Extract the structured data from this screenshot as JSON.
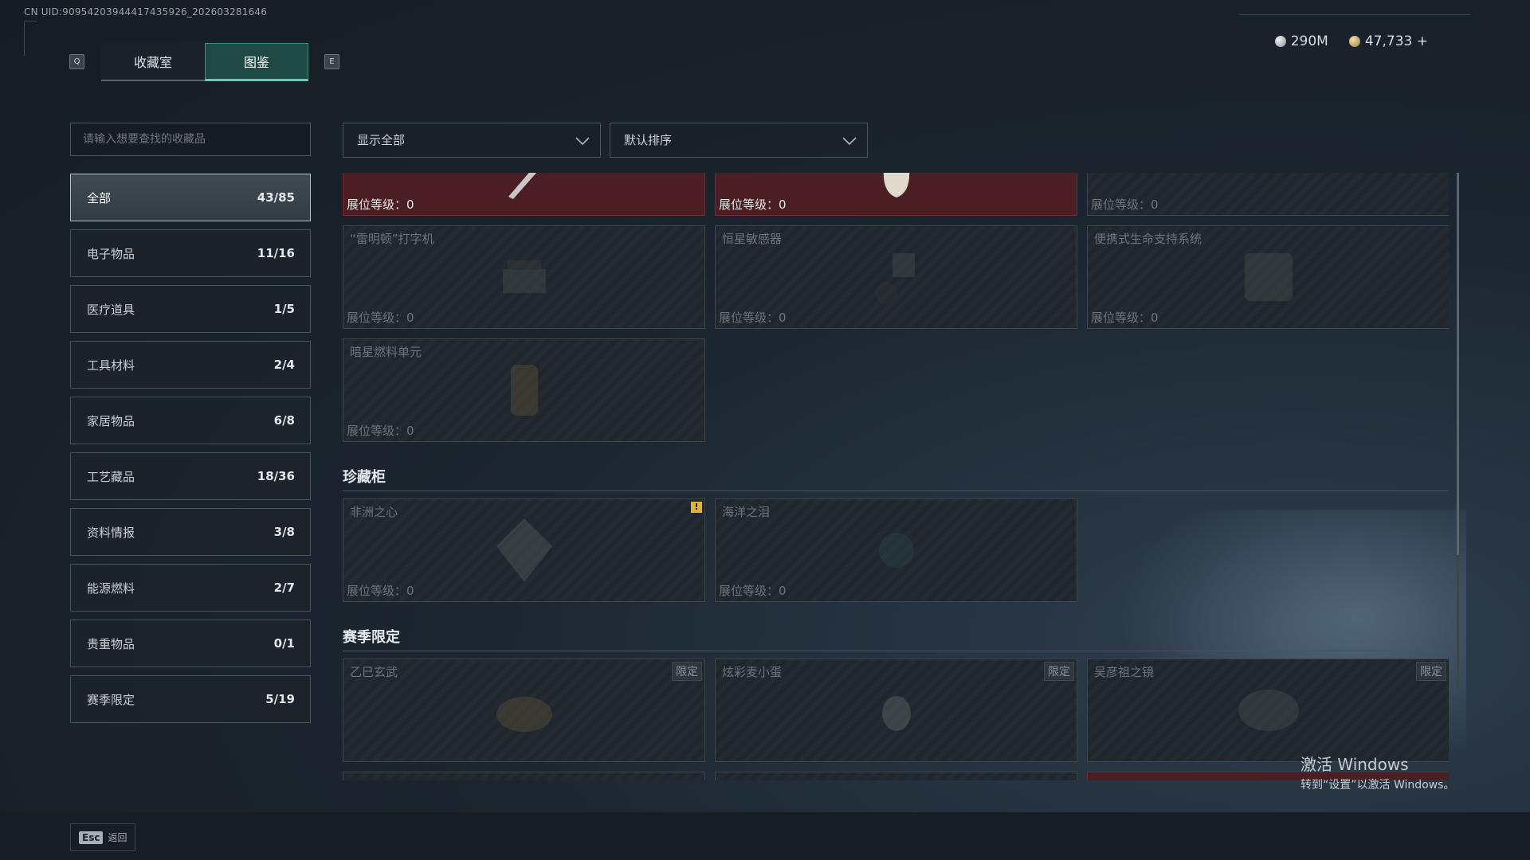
{
  "uid": "CN UID:9095420394441743​5926_202603281646",
  "tabs": {
    "key_left": "Q",
    "key_right": "E",
    "items": [
      {
        "label": "收藏室",
        "active": false
      },
      {
        "label": "图鉴",
        "active": true
      }
    ]
  },
  "currency": {
    "silver": "290M",
    "gold": "47,733 +",
    "accent": "#5ed1b0"
  },
  "search": {
    "placeholder": "请输入想要查找的收藏品"
  },
  "filters": {
    "show": "显示全部",
    "sort": "默认排序"
  },
  "sidebar": {
    "items": [
      {
        "label": "全部",
        "count": "43/85"
      },
      {
        "label": "电子物品",
        "count": "11/16"
      },
      {
        "label": "医疗道具",
        "count": "1/5"
      },
      {
        "label": "工具材料",
        "count": "2/4"
      },
      {
        "label": "家居物品",
        "count": "6/8"
      },
      {
        "label": "工艺藏品",
        "count": "18/36"
      },
      {
        "label": "资料情报",
        "count": "3/8"
      },
      {
        "label": "能源燃料",
        "count": "2/7"
      },
      {
        "label": "贵重物品",
        "count": "0/1"
      },
      {
        "label": "赛季限定",
        "count": "5/19"
      }
    ]
  },
  "level_label": "展位等级：",
  "level_value": "0",
  "grid1": [
    {
      "name": "",
      "owned": true
    },
    {
      "name": "",
      "owned": true
    },
    {
      "name": "",
      "owned": false
    },
    {
      "name": "“雷明顿”打字机",
      "owned": false
    },
    {
      "name": "恒星敏感器",
      "owned": false
    },
    {
      "name": "便携式生命支持系统",
      "owned": false
    },
    {
      "name": "暗星燃料单元",
      "owned": false
    }
  ],
  "section_cabinet": {
    "title": "珍藏柜",
    "items": [
      {
        "name": "非洲之心",
        "alert": "!"
      },
      {
        "name": "海洋之泪"
      }
    ]
  },
  "section_season": {
    "title": "赛季限定",
    "badge": "限定",
    "items": [
      {
        "name": "乙巳玄武"
      },
      {
        "name": "炫彩麦小蛋"
      },
      {
        "name": "吴彦祖之镜"
      }
    ]
  },
  "footer": {
    "esc_key": "Esc",
    "back_label": "返回"
  },
  "watermark": {
    "line1": "激活 Windows",
    "line2": "转到“设置”以激活 Windows。"
  }
}
